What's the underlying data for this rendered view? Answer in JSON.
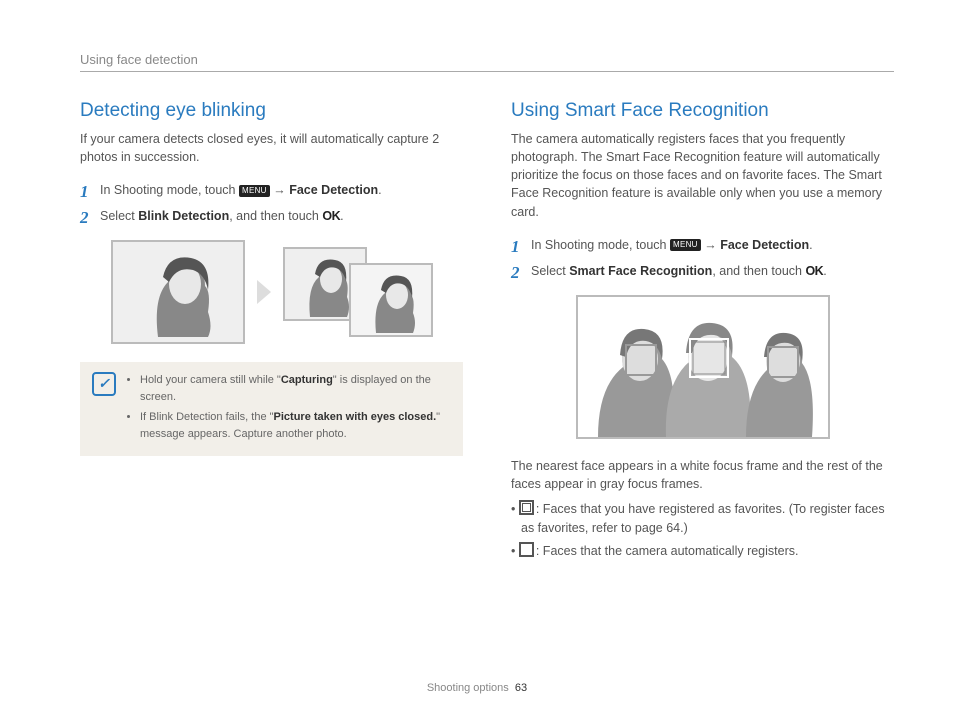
{
  "running_head": "Using face detection",
  "footer": {
    "section": "Shooting options",
    "page": "63"
  },
  "left": {
    "title": "Detecting eye blinking",
    "intro": "If your camera detects closed eyes, it will automatically capture 2 photos in succession.",
    "step1": {
      "a": "In Shooting mode, touch ",
      "menu": "MENU",
      "arrow": " → ",
      "b": "Face Detection",
      "c": "."
    },
    "step2": {
      "a": "Select ",
      "b": "Blink Detection",
      "c": ", and then touch ",
      "ok": "OK",
      "d": "."
    },
    "note1": {
      "a": "Hold your camera still while \"",
      "b": "Capturing",
      "c": "\" is displayed on the screen."
    },
    "note2": {
      "a": "If Blink Detection fails, the \"",
      "b": "Picture taken with eyes closed.",
      "c": "\" message appears. Capture another photo."
    }
  },
  "right": {
    "title": "Using Smart Face Recognition",
    "intro": "The camera automatically registers faces that you frequently photograph. The Smart Face Recognition feature will automatically prioritize the focus on those faces and on favorite faces. The Smart Face Recognition feature is available only when you use a memory card.",
    "step1": {
      "a": "In Shooting mode, touch ",
      "menu": "MENU",
      "arrow": " → ",
      "b": "Face Detection",
      "c": "."
    },
    "step2": {
      "a": "Select ",
      "b": "Smart Face Recognition",
      "c": ", and then touch ",
      "ok": "OK",
      "d": "."
    },
    "after": "The nearest face appears in a white focus frame and the rest of the faces appear in gray focus frames.",
    "legend1": ": Faces that you have registered as favorites. (To register faces as favorites, refer to page 64.)",
    "legend2": ": Faces that the camera automatically registers."
  }
}
